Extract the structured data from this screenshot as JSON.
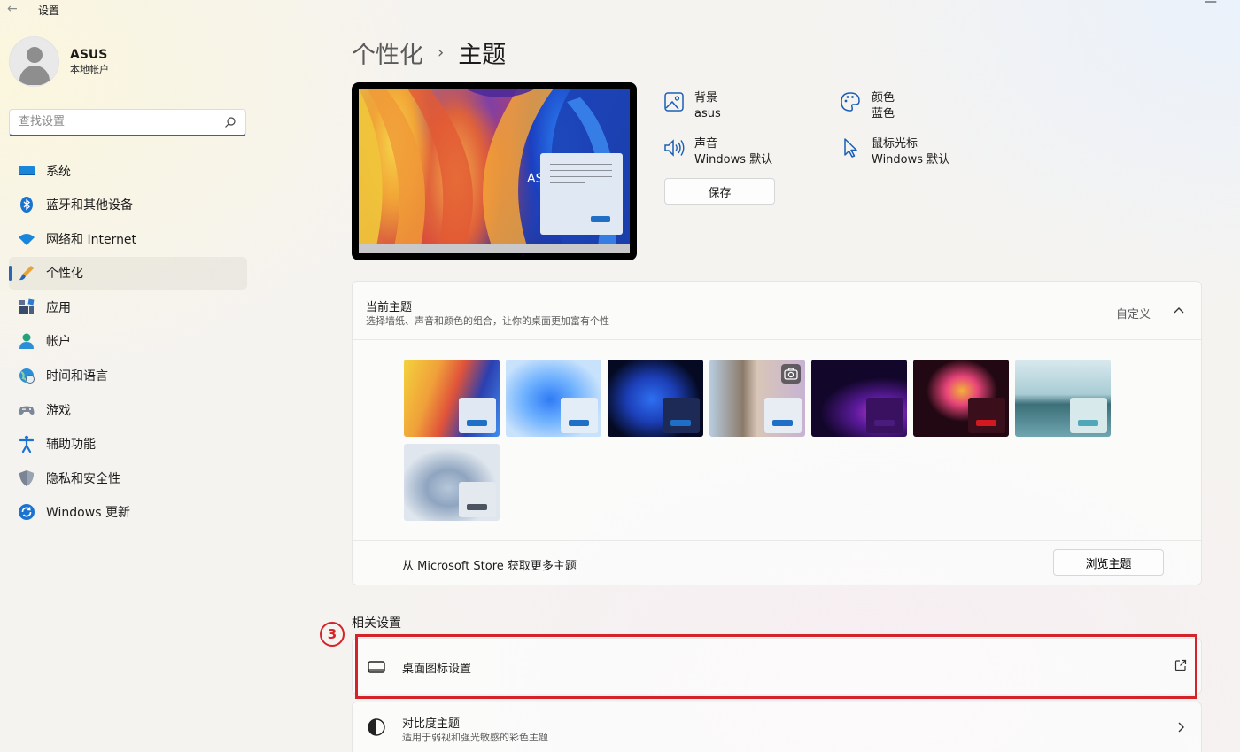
{
  "window": {
    "back_glyph": "←",
    "title": "设置",
    "control_glyph": "—"
  },
  "profile": {
    "name": "ASUS",
    "account_type": "本地帐户"
  },
  "search": {
    "placeholder": "查找设置"
  },
  "sidebar": {
    "items": [
      {
        "label": "系统",
        "icon": "display-icon"
      },
      {
        "label": "蓝牙和其他设备",
        "icon": "bluetooth-icon"
      },
      {
        "label": "网络和 Internet",
        "icon": "wifi-icon"
      },
      {
        "label": "个性化",
        "icon": "brush-icon",
        "active": true
      },
      {
        "label": "应用",
        "icon": "apps-icon"
      },
      {
        "label": "帐户",
        "icon": "person-icon"
      },
      {
        "label": "时间和语言",
        "icon": "globe-clock-icon"
      },
      {
        "label": "游戏",
        "icon": "gamepad-icon"
      },
      {
        "label": "辅助功能",
        "icon": "accessibility-icon"
      },
      {
        "label": "隐私和安全性",
        "icon": "shield-icon"
      },
      {
        "label": "Windows 更新",
        "icon": "update-icon"
      }
    ]
  },
  "breadcrumb": {
    "parent": "个性化",
    "separator": "›",
    "current": "主题"
  },
  "preview": {
    "brand_text": "ASU"
  },
  "theme_info": {
    "background": {
      "label": "背景",
      "value": "asus"
    },
    "color": {
      "label": "颜色",
      "value": "蓝色"
    },
    "sound": {
      "label": "声音",
      "value": "Windows 默认"
    },
    "cursor": {
      "label": "鼠标光标",
      "value": "Windows 默认"
    },
    "save_label": "保存"
  },
  "current_theme": {
    "title": "当前主题",
    "subtitle": "选择墙纸、声音和颜色的组合，让你的桌面更加富有个性",
    "status": "自定义",
    "store_text": "从 Microsoft Store 获取更多主题",
    "browse_label": "浏览主题",
    "themes": [
      {
        "name": "asus",
        "accent": "#1f6fc7"
      },
      {
        "name": "windows-light",
        "accent": "#1f6fc7"
      },
      {
        "name": "windows-dark",
        "accent": "#1f6fc7"
      },
      {
        "name": "windows-spotlight",
        "accent": "#1f6fc7"
      },
      {
        "name": "glow",
        "accent": "#4b1a7d"
      },
      {
        "name": "captured-motion",
        "accent": "#d3191f"
      },
      {
        "name": "sunrise",
        "accent": "#4fa7b8"
      },
      {
        "name": "flow",
        "accent": "#4b5460"
      }
    ]
  },
  "related": {
    "section_title": "相关设置",
    "step_marker": "3",
    "desktop_icons": {
      "title": "桌面图标设置"
    },
    "contrast": {
      "title": "对比度主题",
      "subtitle": "适用于弱视和强光敏感的彩色主题"
    }
  },
  "colors": {
    "accent": "#2a66b0",
    "highlight": "#d5232a"
  }
}
